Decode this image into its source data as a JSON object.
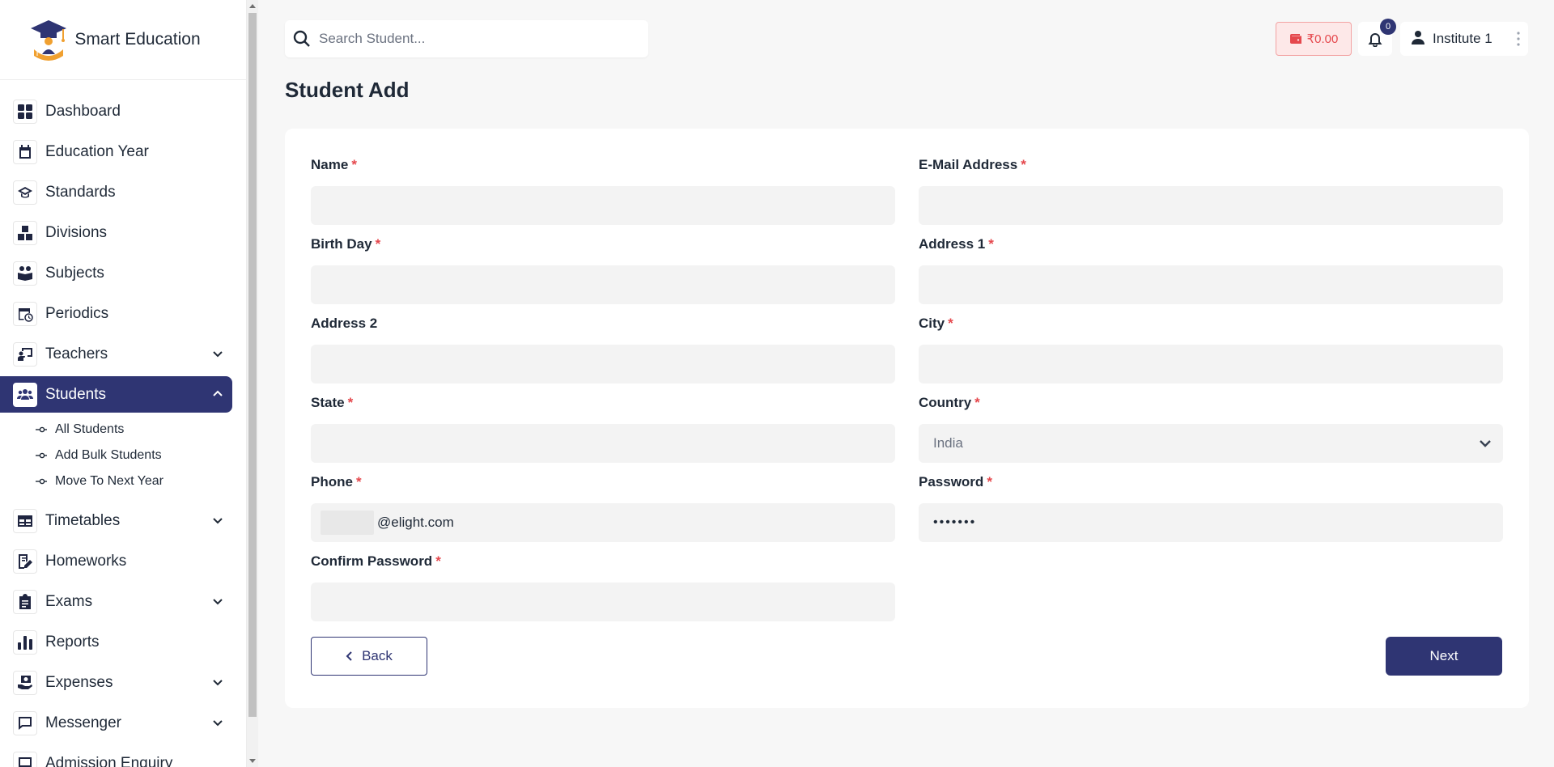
{
  "brand": {
    "name": "Smart Education"
  },
  "sidebar": {
    "items": [
      {
        "label": "Dashboard"
      },
      {
        "label": "Education Year"
      },
      {
        "label": "Standards"
      },
      {
        "label": "Divisions"
      },
      {
        "label": "Subjects"
      },
      {
        "label": "Periodics"
      },
      {
        "label": "Teachers"
      },
      {
        "label": "Students"
      },
      {
        "label": "Timetables"
      },
      {
        "label": "Homeworks"
      },
      {
        "label": "Exams"
      },
      {
        "label": "Reports"
      },
      {
        "label": "Expenses"
      },
      {
        "label": "Messenger"
      },
      {
        "label": "Admission Enquiry"
      }
    ],
    "students_sub": [
      {
        "label": "All Students"
      },
      {
        "label": "Add Bulk Students"
      },
      {
        "label": "Move To Next Year"
      }
    ]
  },
  "header": {
    "search_placeholder": "Search Student...",
    "wallet": "₹0.00",
    "notifications_count": "0",
    "user_name": "Institute 1"
  },
  "page": {
    "title": "Student Add"
  },
  "form": {
    "required_mark": "*",
    "name_label": "Name",
    "email_label": "E-Mail Address",
    "birthday_label": "Birth Day",
    "address1_label": "Address 1",
    "address2_label": "Address 2",
    "city_label": "City",
    "state_label": "State",
    "country_label": "Country",
    "country_value": "India",
    "phone_label": "Phone",
    "phone_value": "@elight.com",
    "password_label": "Password",
    "password_value": "•••••••",
    "confirm_password_label": "Confirm Password",
    "back_label": "Back",
    "next_label": "Next"
  },
  "colors": {
    "primary": "#2f3573",
    "danger": "#e5484d",
    "input_bg": "#f3f3f3",
    "page_bg": "#f7f7f7"
  }
}
